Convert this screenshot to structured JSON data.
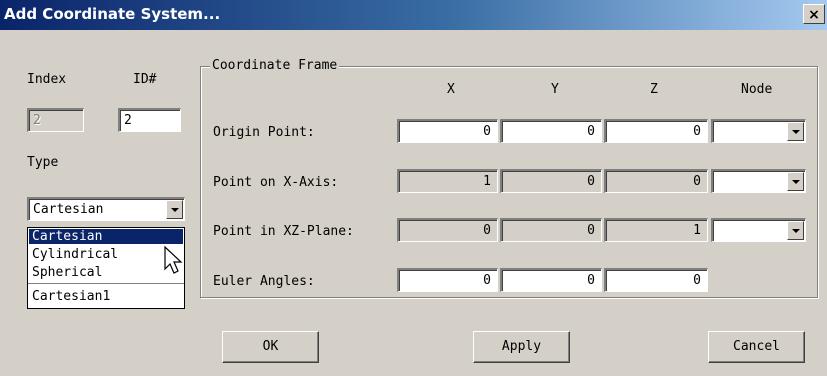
{
  "window": {
    "title": "Add Coordinate System...",
    "close_label": "×"
  },
  "left": {
    "index_label": "Index",
    "id_label": "ID#",
    "index_value": "2",
    "id_value": "2",
    "type_label": "Type",
    "type_selected": "Cartesian",
    "type_options": [
      "Cartesian",
      "Cylindrical",
      "Spherical",
      "Cartesian1"
    ]
  },
  "frame": {
    "title": "Coordinate Frame",
    "columns": [
      "X",
      "Y",
      "Z",
      "Node"
    ],
    "rows": [
      {
        "label": "Origin Point:",
        "x": "0",
        "y": "0",
        "z": "0",
        "node": ""
      },
      {
        "label": "Point on X-Axis:",
        "x": "1",
        "y": "0",
        "z": "0",
        "node": ""
      },
      {
        "label": "Point in XZ-Plane:",
        "x": "0",
        "y": "0",
        "z": "1",
        "node": ""
      },
      {
        "label": "Euler Angles:",
        "x": "0",
        "y": "0",
        "z": "0"
      }
    ]
  },
  "buttons": {
    "ok": "OK",
    "apply": "Apply",
    "cancel": "Cancel"
  }
}
